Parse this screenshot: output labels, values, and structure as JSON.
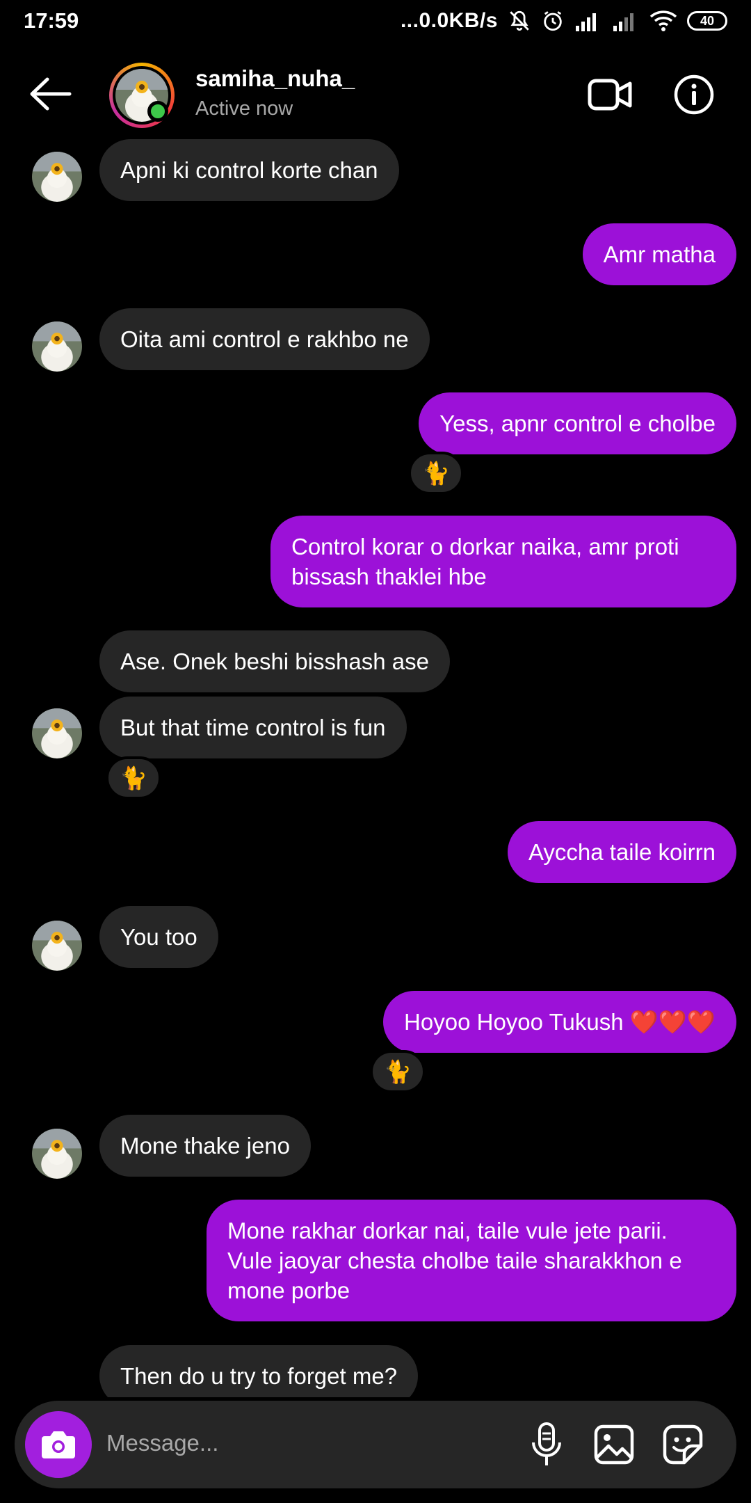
{
  "status_bar": {
    "time": "17:59",
    "network_speed": "...0.0KB/s",
    "battery": "40"
  },
  "header": {
    "username": "samiha_nuha_",
    "status": "Active now"
  },
  "messages": [
    {
      "side": "in",
      "text": "Apni ki control korte chan"
    },
    {
      "side": "out",
      "text": "Amr matha"
    },
    {
      "side": "in",
      "text": "Oita ami control e rakhbo ne"
    },
    {
      "side": "out",
      "text": "Yess, apnr control e cholbe",
      "reaction": "🐈"
    },
    {
      "side": "out",
      "text": "Control korar o dorkar naika, amr proti bissash thaklei hbe"
    },
    {
      "side": "in",
      "text": "Ase. Onek beshi bisshash ase"
    },
    {
      "side": "in",
      "text": "But that time control is fun",
      "reaction": "🐈"
    },
    {
      "side": "out",
      "text": "Ayccha taile koirrn"
    },
    {
      "side": "in",
      "text": "You too"
    },
    {
      "side": "out",
      "text": "Hoyoo Hoyoo Tukush ❤️❤️❤️",
      "reaction": "🐈"
    },
    {
      "side": "in",
      "text": "Mone thake jeno"
    },
    {
      "side": "out",
      "text": "Mone rakhar dorkar nai, taile vule jete parii. Vule jaoyar chesta cholbe taile sharakkhon e mone porbe"
    },
    {
      "side": "in",
      "text": "Then do u try to forget me?"
    }
  ],
  "composer": {
    "placeholder": "Message..."
  },
  "icons": [
    "back-arrow-icon",
    "video-call-icon",
    "info-icon",
    "camera-icon",
    "microphone-icon",
    "gallery-icon",
    "sticker-icon"
  ],
  "colors": {
    "outgoing_bubble": "#9c11d8",
    "incoming_bubble": "#262626",
    "online": "#3ec84a",
    "camera_button": "#a21fde"
  }
}
